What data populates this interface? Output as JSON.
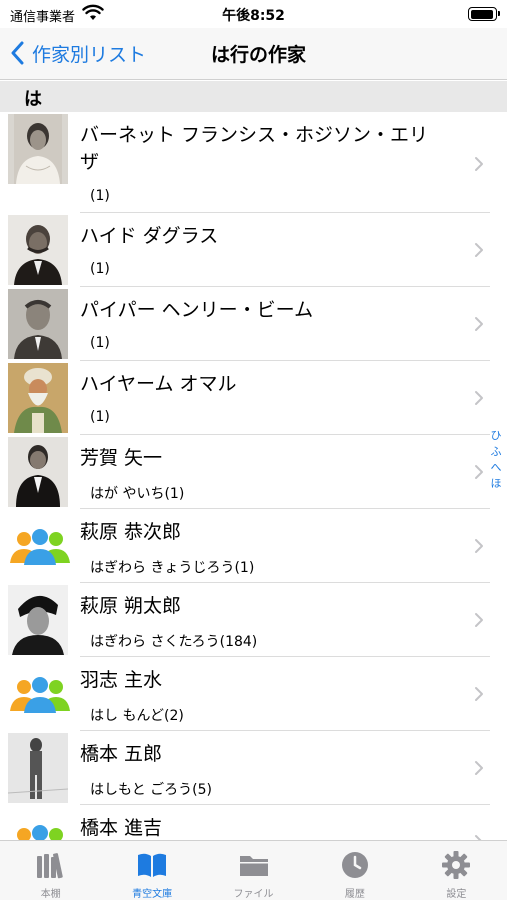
{
  "status_bar": {
    "carrier": "通信事業者",
    "time": "午後8:52"
  },
  "nav": {
    "back_label": "作家別リスト",
    "title": "は行の作家"
  },
  "section": {
    "header": "は"
  },
  "authors": [
    {
      "name": "バーネット フランシス・ホジソン・エリザ",
      "sub": "(1)",
      "thumb": "portrait-photo"
    },
    {
      "name": "ハイド ダグラス",
      "sub": "(1)",
      "thumb": "portrait-photo"
    },
    {
      "name": "パイパー ヘンリー・ビーム",
      "sub": "(1)",
      "thumb": "portrait-photo"
    },
    {
      "name": "ハイヤーム オマル",
      "sub": "(1)",
      "thumb": "portrait-painting"
    },
    {
      "name": "芳賀 矢一",
      "sub": "はが やいち(1)",
      "thumb": "portrait-photo"
    },
    {
      "name": "萩原 恭次郎",
      "sub": "はぎわら きょうじろう(1)",
      "thumb": "people-group-icon"
    },
    {
      "name": "萩原 朔太郎",
      "sub": "はぎわら さくたろう(184)",
      "thumb": "portrait-photo"
    },
    {
      "name": "羽志 主水",
      "sub": "はし もんど(2)",
      "thumb": "people-group-icon"
    },
    {
      "name": "橋本 五郎",
      "sub": "はしもと ごろう(5)",
      "thumb": "portrait-photo"
    },
    {
      "name": "橋本 進吉",
      "sub": "",
      "thumb": "people-group-icon"
    }
  ],
  "index": [
    "ひ",
    "ふ",
    "へ",
    "ほ"
  ],
  "tabs": [
    {
      "label": "本棚",
      "icon": "bookshelf-icon",
      "active": false
    },
    {
      "label": "青空文庫",
      "icon": "open-book-icon",
      "active": true
    },
    {
      "label": "ファイル",
      "icon": "folder-icon",
      "active": false
    },
    {
      "label": "履歴",
      "icon": "clock-icon",
      "active": false
    },
    {
      "label": "設定",
      "icon": "gear-icon",
      "active": false
    }
  ],
  "colors": {
    "accent": "#1e7be0",
    "inactive_tab": "#8e8e93",
    "section_bg": "#e8e8e8"
  }
}
